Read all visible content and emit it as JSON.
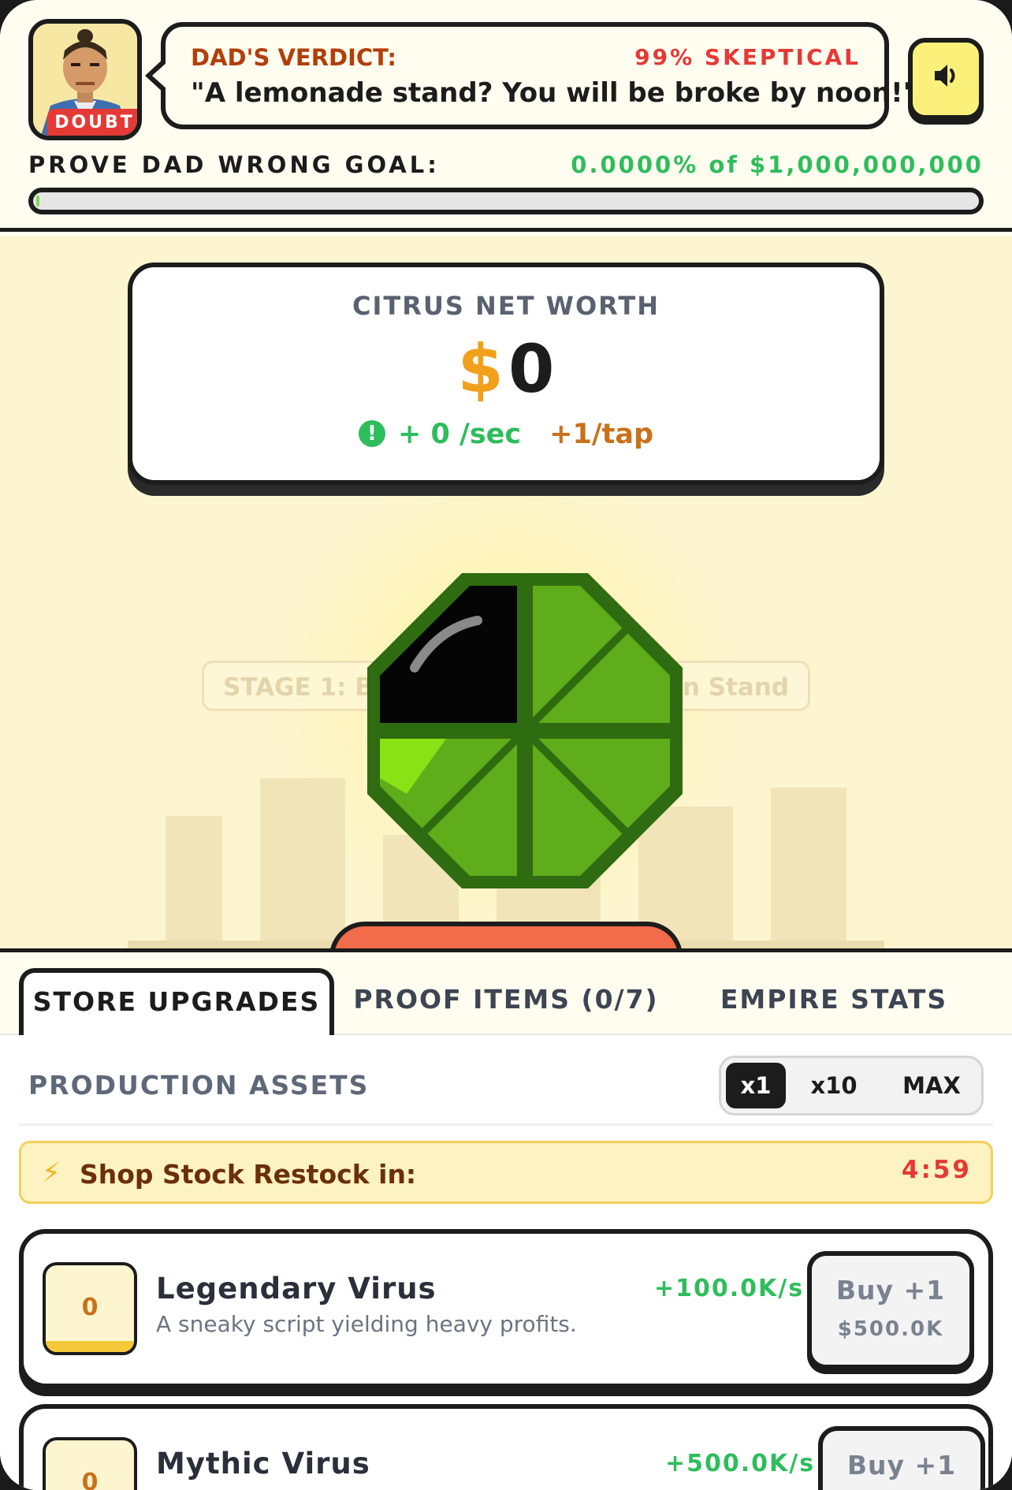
{
  "header": {
    "avatar_badge": "DOUBT",
    "verdict_label": "DAD'S VERDICT:",
    "skeptical": "99% SKEPTICAL",
    "quote": "\"A lemonade stand? You will be broke by noon!\"",
    "goal_label": "PROVE DAD WRONG GOAL:",
    "goal_value": "0.0000% of $1,000,000,000",
    "goal_progress_fraction": 0.0
  },
  "worth": {
    "title": "CITRUS NET WORTH",
    "currency": "$",
    "amount": "0",
    "per_sec": "+ 0 /sec",
    "per_tap": "+1/tap"
  },
  "stage": {
    "label_left": "STAGE 1: B",
    "label_right": "n Stand"
  },
  "tabs": [
    {
      "label": "STORE UPGRADES"
    },
    {
      "label": "PROOF ITEMS (0/7)"
    },
    {
      "label": "EMPIRE STATS"
    }
  ],
  "production": {
    "label": "PRODUCTION ASSETS",
    "quantity_options": [
      "x1",
      "x10",
      "MAX"
    ],
    "selected_quantity": "x1"
  },
  "restock": {
    "icon": "lightning-icon",
    "text": "Shop Stock Restock in:",
    "timer": "4:59"
  },
  "assets": [
    {
      "count": "0",
      "name": "Legendary Virus",
      "description": "A sneaky script yielding heavy profits.",
      "rate": "+100.0K/s",
      "buy_label": "Buy +1",
      "price": "$500.0K"
    },
    {
      "count": "0",
      "name": "Mythic Virus",
      "description": "",
      "rate": "+500.0K/s",
      "buy_label": "Buy +1",
      "price": ""
    }
  ],
  "colors": {
    "accent_green": "#2ebd5c",
    "accent_orange": "#f2a01b",
    "alert_red": "#e53935",
    "background": "#fffdf0"
  }
}
